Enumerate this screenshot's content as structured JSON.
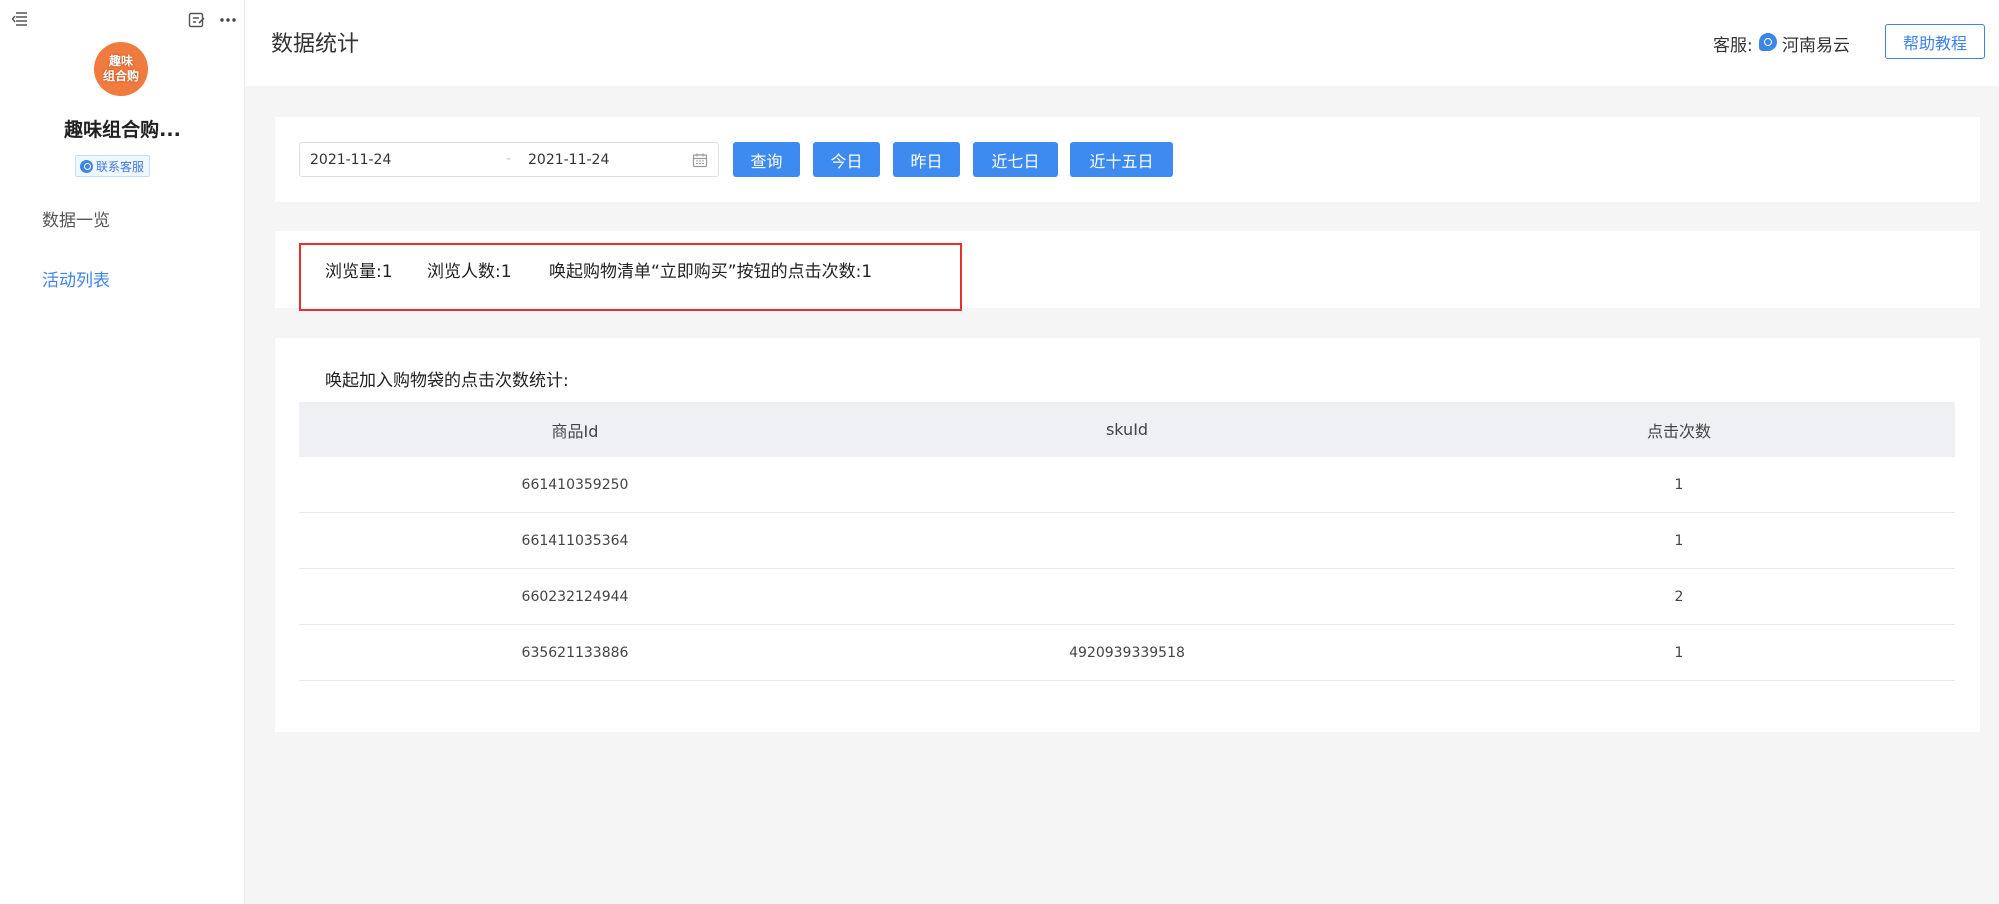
{
  "sidebar": {
    "logo_text": "趣味\n组合购",
    "shop_name": "趣味组合购...",
    "contact_label": "联系客服",
    "nav": [
      {
        "label": "数据一览",
        "active": false
      },
      {
        "label": "活动列表",
        "active": true
      }
    ]
  },
  "header": {
    "title": "数据统计",
    "service_label": "客服:",
    "service_name": "河南易云",
    "help_label": "帮助教程"
  },
  "filter": {
    "date_start": "2021-11-24",
    "date_sep": "-",
    "date_end": "2021-11-24",
    "buttons": [
      "查询",
      "今日",
      "昨日",
      "近七日",
      "近十五日"
    ]
  },
  "stats": {
    "views": "浏览量:1",
    "visitors": "浏览人数:1",
    "buy_clicks": "唤起购物清单“立即购买”按钮的点击次数:1"
  },
  "table": {
    "title": "唤起加入购物袋的点击次数统计:",
    "columns": [
      "商品Id",
      "skuId",
      "点击次数"
    ],
    "rows": [
      [
        "661410359250",
        "",
        "1"
      ],
      [
        "661411035364",
        "",
        "1"
      ],
      [
        "660232124944",
        "",
        "2"
      ],
      [
        "635621133886",
        "4920939339518",
        "1"
      ]
    ]
  },
  "colors": {
    "accent": "#3d8af0",
    "highlight_border": "#e53030",
    "logo": "#f07b3f"
  }
}
